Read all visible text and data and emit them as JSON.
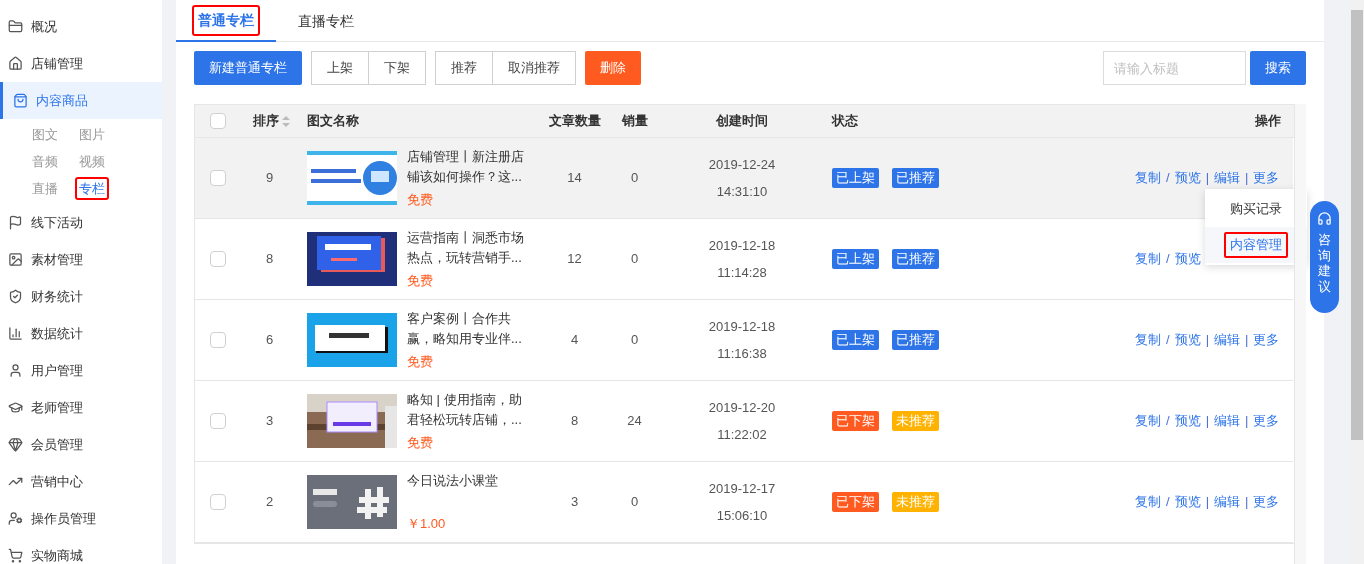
{
  "sidebar": {
    "items": [
      {
        "label": "概况",
        "selected": false
      },
      {
        "label": "店铺管理",
        "selected": false
      },
      {
        "label": "内容商品",
        "selected": true,
        "children": [
          {
            "label": "图文",
            "selected": false,
            "highlighted": false
          },
          {
            "label": "图片",
            "selected": false,
            "highlighted": false
          },
          {
            "label": "音频",
            "selected": false,
            "highlighted": false
          },
          {
            "label": "视频",
            "selected": false,
            "highlighted": false
          },
          {
            "label": "直播",
            "selected": false,
            "highlighted": false
          },
          {
            "label": "专栏",
            "selected": true,
            "highlighted": true
          }
        ]
      },
      {
        "label": "线下活动",
        "selected": false
      },
      {
        "label": "素材管理",
        "selected": false
      },
      {
        "label": "财务统计",
        "selected": false
      },
      {
        "label": "数据统计",
        "selected": false
      },
      {
        "label": "用户管理",
        "selected": false
      },
      {
        "label": "老师管理",
        "selected": false
      },
      {
        "label": "会员管理",
        "selected": false
      },
      {
        "label": "营销中心",
        "selected": false
      },
      {
        "label": "操作员管理",
        "selected": false
      },
      {
        "label": "实物商城",
        "selected": false
      }
    ]
  },
  "tabs": [
    {
      "label": "普通专栏",
      "selected": true,
      "highlighted": true
    },
    {
      "label": "直播专栏",
      "selected": false,
      "highlighted": false
    }
  ],
  "toolbar": {
    "primary": "新建普通专栏",
    "groups": [
      [
        "上架",
        "下架"
      ],
      [
        "推荐",
        "取消推荐"
      ]
    ],
    "danger": "删除"
  },
  "search": {
    "placeholder": "请输入标题",
    "button": "搜索"
  },
  "table": {
    "select_all": {
      "checked": false
    },
    "columns": [
      "排序",
      "图文名称",
      "文章数量",
      "销量",
      "创建时间",
      "状态",
      "操作"
    ],
    "rows": [
      {
        "selected": false,
        "hovered": true,
        "order": "9",
        "title": "店铺管理丨新注册店铺该如何操作？这...",
        "price": "免费",
        "articles": "14",
        "sales": "0",
        "date": "2019-12-24",
        "time": "14:31:10",
        "tags": [
          {
            "text": "已上架",
            "color": "#2d74e8"
          },
          {
            "text": "已推荐",
            "color": "#2d74e8"
          }
        ],
        "actions": [
          {
            "kind": "link",
            "text": "复制"
          },
          {
            "kind": "sep",
            "text": "/"
          },
          {
            "kind": "link",
            "text": "预览"
          },
          {
            "kind": "sep",
            "text": "|"
          },
          {
            "kind": "link",
            "text": "编辑"
          },
          {
            "kind": "sep",
            "text": "|"
          },
          {
            "kind": "link",
            "text": "更多"
          }
        ]
      },
      {
        "selected": false,
        "hovered": false,
        "order": "8",
        "title": "运营指南丨洞悉市场热点，玩转营销手...",
        "price": "免费",
        "articles": "12",
        "sales": "0",
        "date": "2019-12-18",
        "time": "11:14:28",
        "tags": [
          {
            "text": "已上架",
            "color": "#2d74e8"
          },
          {
            "text": "已推荐",
            "color": "#2d74e8"
          }
        ],
        "actions": [
          {
            "kind": "link",
            "text": "复制"
          },
          {
            "kind": "sep",
            "text": "/"
          },
          {
            "kind": "link",
            "text": "预览"
          }
        ]
      },
      {
        "selected": false,
        "hovered": false,
        "order": "6",
        "title": "客户案例丨合作共赢，略知用专业伴...",
        "price": "免费",
        "articles": "4",
        "sales": "0",
        "date": "2019-12-18",
        "time": "11:16:38",
        "tags": [
          {
            "text": "已上架",
            "color": "#2d74e8"
          },
          {
            "text": "已推荐",
            "color": "#2d74e8"
          }
        ],
        "actions": [
          {
            "kind": "link",
            "text": "复制"
          },
          {
            "kind": "sep",
            "text": "/"
          },
          {
            "kind": "link",
            "text": "预览"
          },
          {
            "kind": "sep",
            "text": "|"
          },
          {
            "kind": "link",
            "text": "编辑"
          },
          {
            "kind": "sep",
            "text": "|"
          },
          {
            "kind": "link",
            "text": "更多"
          }
        ]
      },
      {
        "selected": false,
        "hovered": false,
        "order": "3",
        "title": "略知 | 使用指南，助君轻松玩转店铺，...",
        "price": "免费",
        "articles": "8",
        "sales": "24",
        "date": "2019-12-20",
        "time": "11:22:02",
        "tags": [
          {
            "text": "已下架",
            "color": "#ff5a1f"
          },
          {
            "text": "未推荐",
            "color": "#ffb300"
          }
        ],
        "actions": [
          {
            "kind": "link",
            "text": "复制"
          },
          {
            "kind": "sep",
            "text": "/"
          },
          {
            "kind": "link",
            "text": "预览"
          },
          {
            "kind": "sep",
            "text": "|"
          },
          {
            "kind": "link",
            "text": "编辑"
          },
          {
            "kind": "sep",
            "text": "|"
          },
          {
            "kind": "link",
            "text": "更多"
          }
        ]
      },
      {
        "selected": false,
        "hovered": false,
        "order": "2",
        "title": "今日说法小课堂",
        "price": "￥1.00",
        "articles": "3",
        "sales": "0",
        "date": "2019-12-17",
        "time": "15:06:10",
        "tags": [
          {
            "text": "已下架",
            "color": "#ff5a1f"
          },
          {
            "text": "未推荐",
            "color": "#ffb300"
          }
        ],
        "actions": [
          {
            "kind": "link",
            "text": "复制"
          },
          {
            "kind": "sep",
            "text": "/"
          },
          {
            "kind": "link",
            "text": "预览"
          },
          {
            "kind": "sep",
            "text": "|"
          },
          {
            "kind": "link",
            "text": "编辑"
          },
          {
            "kind": "sep",
            "text": "|"
          },
          {
            "kind": "link",
            "text": "更多"
          }
        ]
      }
    ]
  },
  "more_menu": {
    "items": [
      {
        "label": "购买记录",
        "highlighted": false
      },
      {
        "label": "内容管理",
        "highlighted": true
      }
    ]
  },
  "float_button": {
    "label": "咨询建议"
  }
}
